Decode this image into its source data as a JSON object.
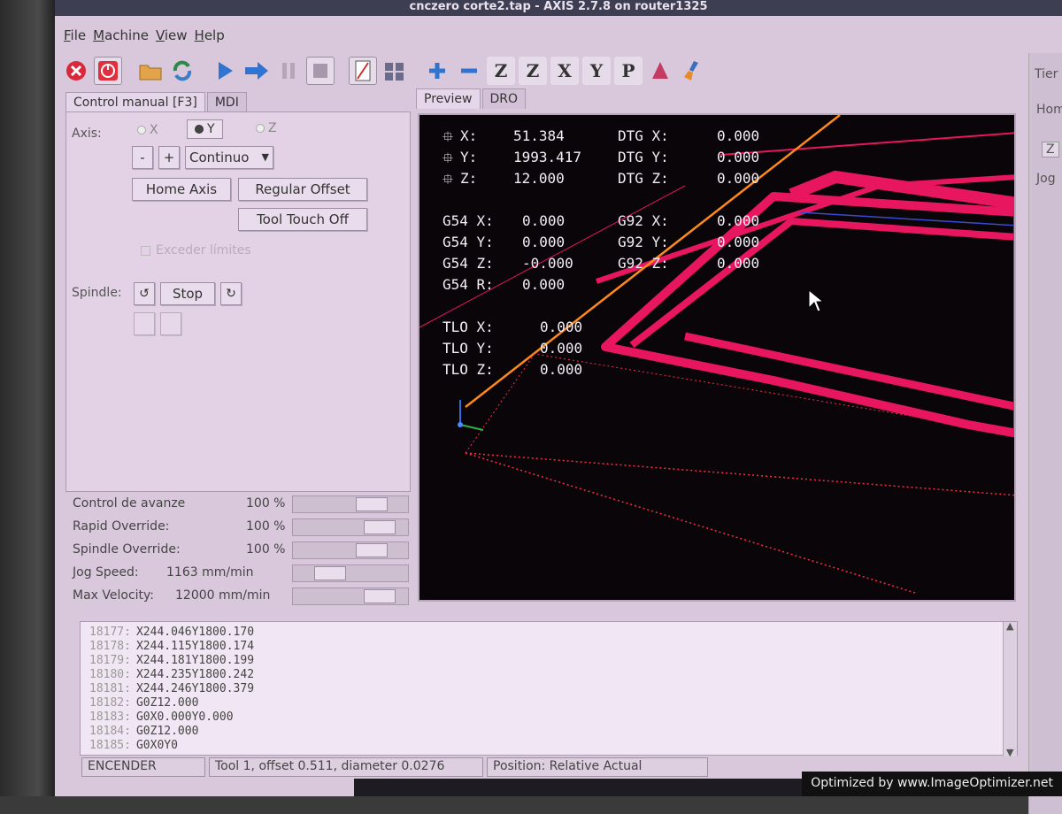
{
  "window": {
    "title": "cnczero corte2.tap - AXIS 2.7.8 on router1325"
  },
  "menu": [
    "File",
    "Machine",
    "View",
    "Help"
  ],
  "toolbar": {
    "letters": [
      "Z",
      "Z",
      "X",
      "Y",
      "P"
    ]
  },
  "right_strip": {
    "top_label": "Tier",
    "home_label": "Hom",
    "z_label": "Z",
    "jog_label": "Jog"
  },
  "left_tabs": [
    "Control manual [F3]",
    "MDI"
  ],
  "manual": {
    "axis_label": "Axis:",
    "axes": [
      {
        "label": "X",
        "selected": false
      },
      {
        "label": "Y",
        "selected": true
      },
      {
        "label": "Z",
        "selected": false
      }
    ],
    "minus": "-",
    "plus": "+",
    "jog_mode": "Continuo",
    "home_axis": "Home Axis",
    "regular_offset": "Regular Offset",
    "tool_touch_off": "Tool Touch Off",
    "exceed_limits": "Exceder límites",
    "spindle_label": "Spindle:",
    "spindle_stop": "Stop"
  },
  "sliders": [
    {
      "name": "Control de avanze",
      "value": "100 %",
      "fraction": 0.75
    },
    {
      "name": "Rapid Override:",
      "value": "100 %",
      "fraction": 0.85
    },
    {
      "name": "Spindle Override:",
      "value": "100 %",
      "fraction": 0.75
    },
    {
      "name": "Jog Speed:",
      "value": "1163 mm/min",
      "fraction": 0.25
    },
    {
      "name": "Max Velocity:",
      "value": "12000 mm/min",
      "fraction": 0.85
    }
  ],
  "view_tabs": [
    "Preview",
    "DRO"
  ],
  "dro": {
    "position": [
      {
        "axis": "X:",
        "value": "51.384",
        "dtg_label": "DTG X:",
        "dtg": "0.000"
      },
      {
        "axis": "Y:",
        "value": "1993.417",
        "dtg_label": "DTG Y:",
        "dtg": "0.000"
      },
      {
        "axis": "Z:",
        "value": "12.000",
        "dtg_label": "DTG Z:",
        "dtg": "0.000"
      }
    ],
    "g54": [
      {
        "label": "G54 X:",
        "value": "0.000",
        "g92_label": "G92 X:",
        "g92": "0.000"
      },
      {
        "label": "G54 Y:",
        "value": "0.000",
        "g92_label": "G92 Y:",
        "g92": "0.000"
      },
      {
        "label": "G54 Z:",
        "value": "-0.000",
        "g92_label": "G92 Z:",
        "g92": "0.000"
      },
      {
        "label": "G54 R:",
        "value": "0.000"
      }
    ],
    "tlo": [
      {
        "label": "TLO X:",
        "value": "0.000"
      },
      {
        "label": "TLO Y:",
        "value": "0.000"
      },
      {
        "label": "TLO Z:",
        "value": "0.000"
      }
    ]
  },
  "gcode": [
    {
      "n": "18177:",
      "code": "X244.046Y1800.170"
    },
    {
      "n": "18178:",
      "code": "X244.115Y1800.174"
    },
    {
      "n": "18179:",
      "code": "X244.181Y1800.199"
    },
    {
      "n": "18180:",
      "code": "X244.235Y1800.242"
    },
    {
      "n": "18181:",
      "code": "X244.246Y1800.379"
    },
    {
      "n": "18182:",
      "code": "G0Z12.000"
    },
    {
      "n": "18183:",
      "code": "G0X0.000Y0.000"
    },
    {
      "n": "18184:",
      "code": "G0Z12.000"
    },
    {
      "n": "18185:",
      "code": "G0X0Y0"
    }
  ],
  "status": {
    "state": "ENCENDER",
    "tool": "Tool 1, offset 0.511, diameter 0.0276",
    "position": "Position: Relative Actual"
  },
  "watermark": "Optimized by www.ImageOptimizer.net",
  "colors": {
    "toolpath": "#e8155f",
    "rapid": "#ff2a4a",
    "tool_line": "#ff8a1a",
    "preview_bg": "#0a0508"
  }
}
